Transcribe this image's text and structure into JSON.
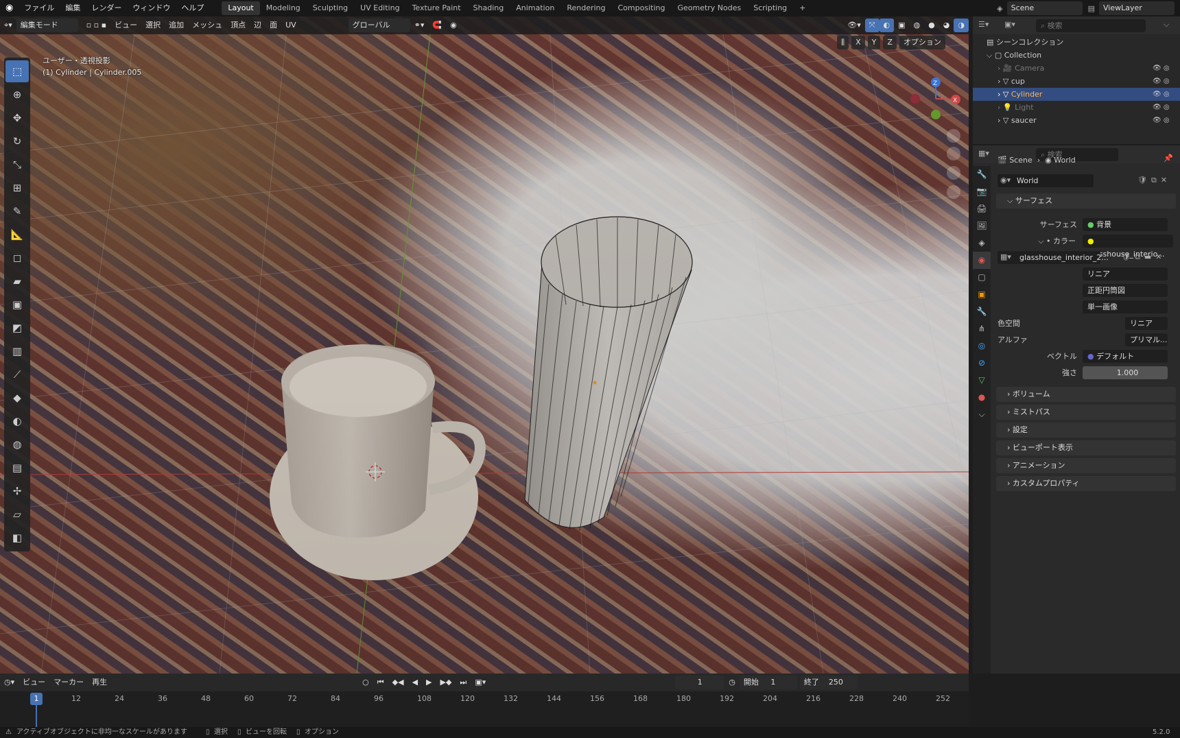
{
  "topmenu": {
    "items": [
      "ファイル",
      "編集",
      "レンダー",
      "ウィンドウ",
      "ヘルプ"
    ]
  },
  "workspaces": [
    "Layout",
    "Modeling",
    "Sculpting",
    "UV Editing",
    "Texture Paint",
    "Shading",
    "Animation",
    "Rendering",
    "Compositing",
    "Geometry Nodes",
    "Scripting"
  ],
  "active_workspace": "Layout",
  "scene": {
    "name": "Scene",
    "view_layer": "ViewLayer"
  },
  "viewport_header": {
    "mode": "編集モード",
    "menus": [
      "ビュー",
      "選択",
      "追加",
      "メッシュ",
      "頂点",
      "辺",
      "面",
      "UV"
    ],
    "transform": "グローバル",
    "options": "オプション",
    "axes": [
      "X",
      "Y",
      "Z"
    ]
  },
  "viewport_info": {
    "view": "ユーザー・透視投影",
    "object": "(1) Cylinder | Cylinder.005"
  },
  "outliner": {
    "search_placeholder": "検索",
    "scene_collection": "シーンコレクション",
    "collection": "Collection",
    "items": [
      {
        "name": "Camera",
        "dim": true
      },
      {
        "name": "cup",
        "dim": false
      },
      {
        "name": "Cylinder",
        "dim": false,
        "selected": true
      },
      {
        "name": "Light",
        "dim": true
      },
      {
        "name": "saucer",
        "dim": false
      }
    ]
  },
  "properties": {
    "search_placeholder": "検索",
    "breadcrumb": [
      "Scene",
      "World"
    ],
    "world_name": "World",
    "surface_panel": "サーフェス",
    "surface_label": "サーフェス",
    "surface_value": "背景",
    "color_label": "カラー",
    "color_value": "glasshouse_interio...",
    "image_name": "glasshouse_interior_2...",
    "interp": "リニア",
    "projection": "正距円筒図",
    "source": "単一画像",
    "colorspace_label": "色空間",
    "colorspace_value": "リニア Re...",
    "alpha_label": "アルファ",
    "alpha_value": "プリマル...",
    "vector_label": "ベクトル",
    "vector_value": "デフォルト",
    "strength_label": "強さ",
    "strength_value": "1.000",
    "collapsed_panels": [
      "ボリューム",
      "ミストパス",
      "設定",
      "ビューポート表示",
      "アニメーション",
      "カスタムプロパティ"
    ]
  },
  "timeline": {
    "menus": [
      "ビュー",
      "マーカー",
      "再生"
    ],
    "current_frame": "1",
    "start_label": "開始",
    "start": "1",
    "end_label": "終了",
    "end": "250",
    "ticks": [
      "1",
      "12",
      "24",
      "36",
      "48",
      "60",
      "72",
      "84",
      "96",
      "108",
      "120",
      "132",
      "144",
      "156",
      "168",
      "180",
      "192",
      "204",
      "216",
      "228",
      "240",
      "252"
    ]
  },
  "status": {
    "warning": "アクティブオブジェクトに非均一なスケールがあります",
    "select": "選択",
    "rotate": "ビューを回転",
    "options": "オプション",
    "version": "5.2.0"
  }
}
